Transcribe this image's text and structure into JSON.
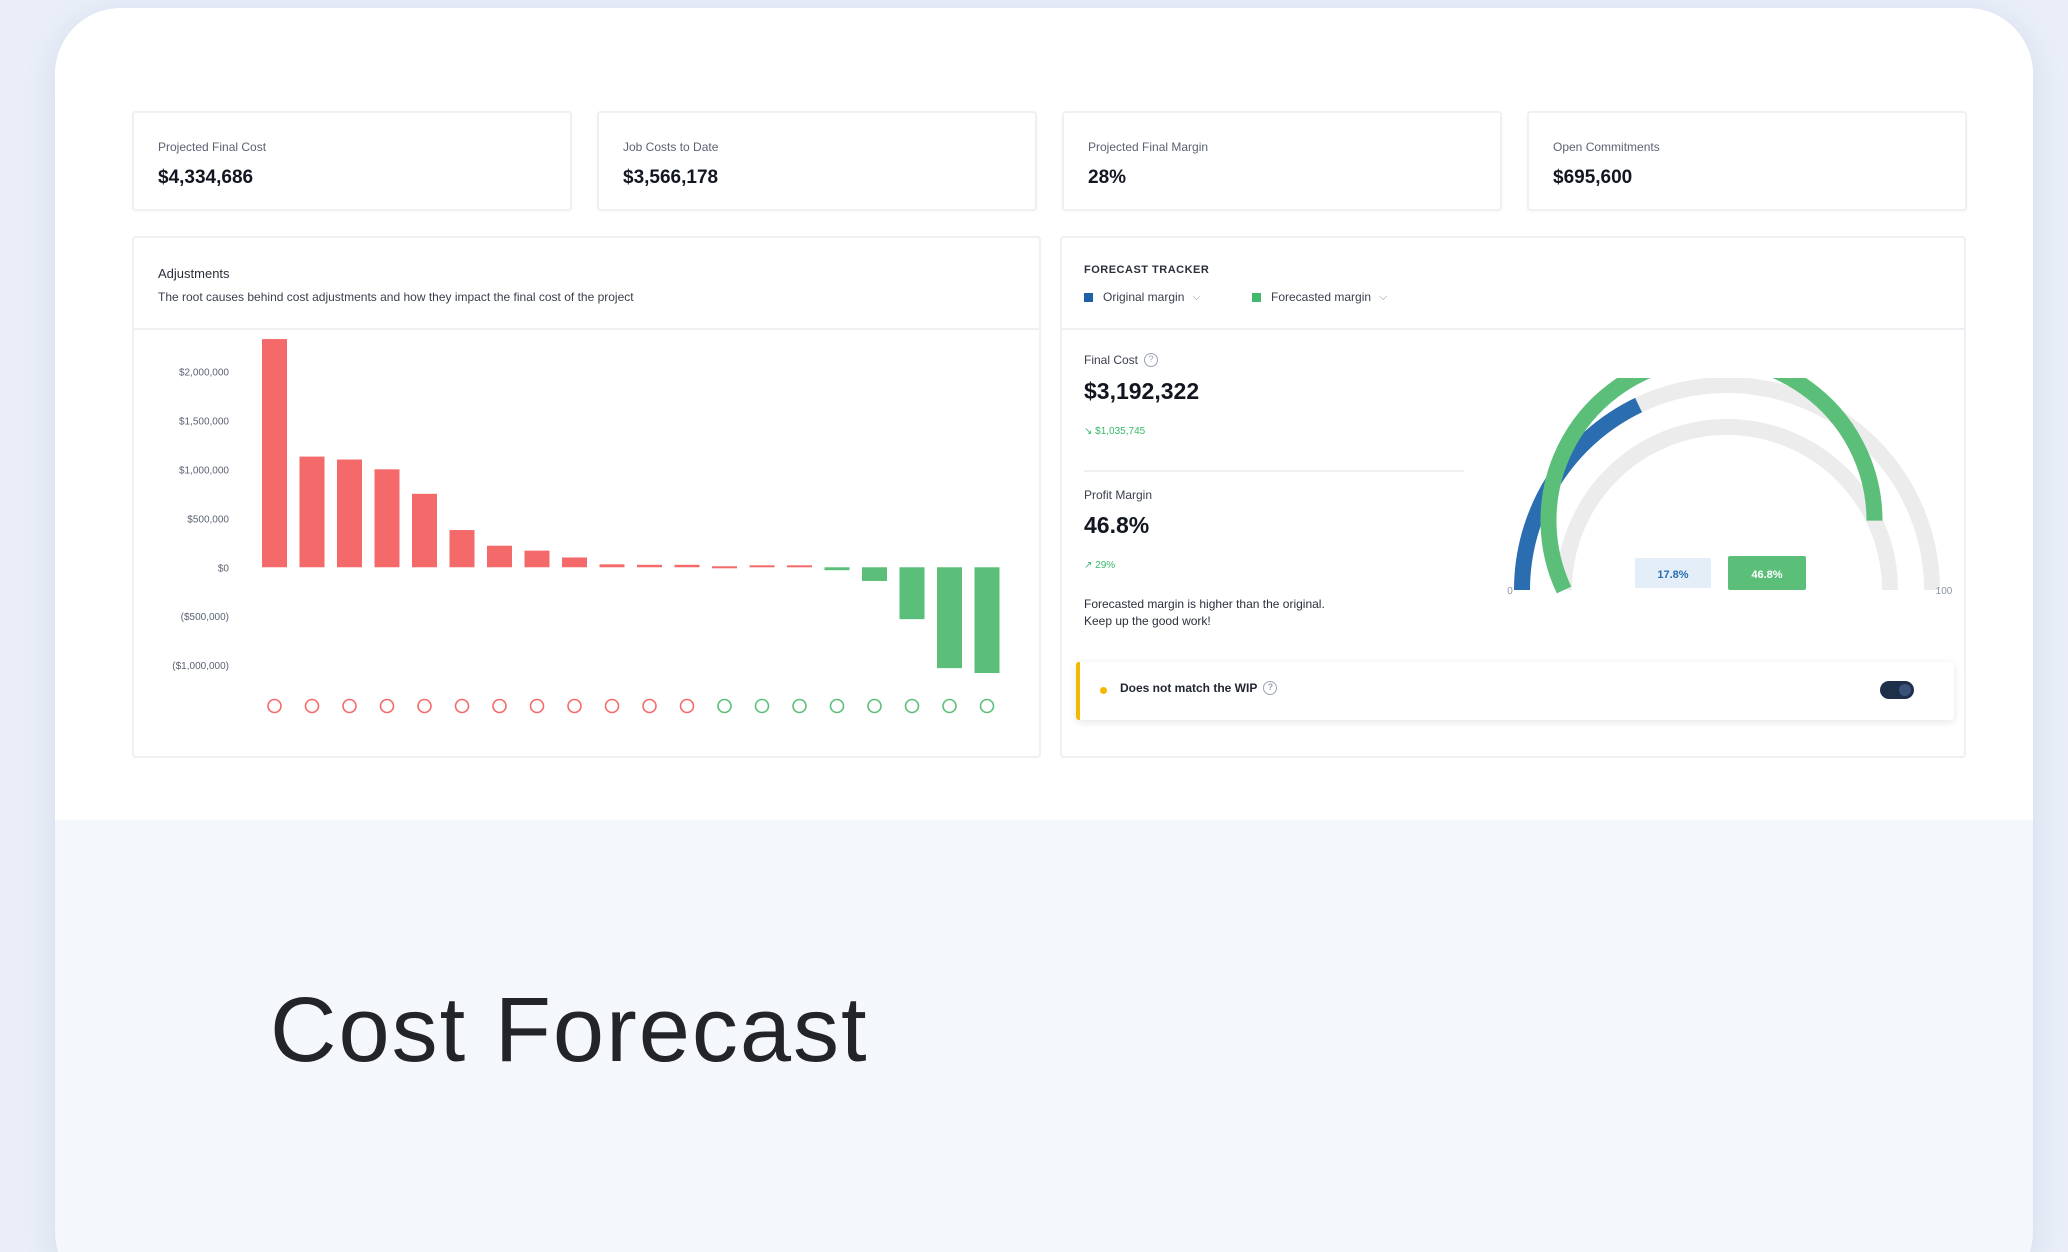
{
  "title": "Cost Forecast",
  "kpis": [
    {
      "label": "Projected Final Cost",
      "value": "$4,334,686"
    },
    {
      "label": "Job Costs to Date",
      "value": "$3,566,178"
    },
    {
      "label": "Projected Final Margin",
      "value": "28%"
    },
    {
      "label": "Open Commitments",
      "value": "$695,600"
    }
  ],
  "adjustments": {
    "title": "Adjustments",
    "subtitle": "The root causes behind cost adjustments and how they impact the final cost of the project"
  },
  "forecast": {
    "title": "FORECAST TRACKER",
    "legend": [
      {
        "label": "Original margin",
        "color": "#1f5fa8"
      },
      {
        "label": "Forecasted margin",
        "color": "#43b86a"
      }
    ],
    "final_cost": {
      "label": "Final Cost",
      "value": "$3,192,322",
      "delta": "↘ $1,035,745"
    },
    "profit_margin": {
      "label": "Profit Margin",
      "value": "46.8%",
      "delta": "↗ 29%"
    },
    "note_line1": "Forecasted margin is higher than the original.",
    "note_line2": "Keep up the good work!",
    "gauge": {
      "original_pct": 17.8,
      "forecast_pct": 46.8,
      "original_label": "17.8%",
      "forecast_label": "46.8%",
      "min_label": "0",
      "max_label": "100"
    },
    "wip": {
      "text": "Does not match the WIP"
    }
  },
  "colors": {
    "negative": "#f46a6a",
    "positive": "#5cbf79",
    "original": "#2a6db0",
    "forecast": "#5cbf79",
    "track": "#ececec"
  },
  "chart_data": {
    "type": "bar",
    "title": "Adjustments",
    "ylim": [
      -1100000,
      2300000
    ],
    "yticks": [
      2000000,
      1500000,
      1000000,
      500000,
      0,
      -500000,
      -1000000
    ],
    "ytick_labels": [
      "$2,000,000",
      "$1,500,000",
      "$1,000,000",
      "$500,000",
      "$0",
      "($500,000)",
      "($1,000,000)"
    ],
    "values": [
      2330000,
      1130000,
      1100000,
      1000000,
      750000,
      380000,
      220000,
      170000,
      100000,
      30000,
      25000,
      25000,
      10000,
      20000,
      20000,
      -30000,
      -140000,
      -530000,
      -1030000,
      -1080000
    ],
    "grid": false
  }
}
